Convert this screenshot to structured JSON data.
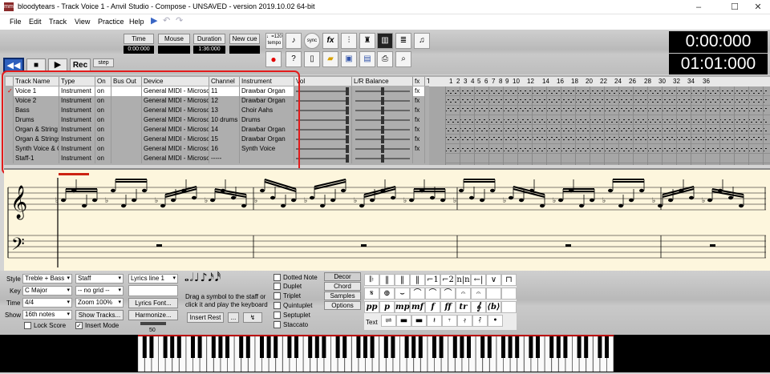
{
  "window": {
    "title": "bloodytears - Track Voice 1 - Anvil Studio - Compose - UNSAVED - version 2019.10.02 64-bit",
    "app_icon": "mm"
  },
  "menu": [
    "File",
    "Edit",
    "Track",
    "View",
    "Practice",
    "Help"
  ],
  "toolbar": {
    "time_label": "Time",
    "mouse_label": "Mouse",
    "duration_label": "Duration",
    "newcue_label": "New cue",
    "time_value": "0:00:000",
    "duration_value": "1:36:000",
    "tempo_label": "♩=120\ntempo",
    "rec_label": "Rec",
    "step_label": "step",
    "sync_label": "sync",
    "fx_label": "fx"
  },
  "clock": {
    "elapsed": "0:00:000",
    "position": "01:01:000"
  },
  "tracks": {
    "headers": [
      "Track Name",
      "Type",
      "On",
      "Bus Out",
      "Device",
      "Channel",
      "Instrument",
      "Vol",
      "L/R Balance",
      "fx",
      "Time"
    ],
    "rows": [
      {
        "name": "Voice 1",
        "type": "Instrument",
        "on": "on",
        "bus": "",
        "device": "General MIDI - Microso",
        "channel": "11",
        "instrument": "Drawbar Organ",
        "fx": "fx"
      },
      {
        "name": "Voice 2",
        "type": "Instrument",
        "on": "on",
        "bus": "",
        "device": "General MIDI - Microso",
        "channel": "12",
        "instrument": "Drawbar Organ",
        "fx": "fx"
      },
      {
        "name": "Bass",
        "type": "Instrument",
        "on": "on",
        "bus": "",
        "device": "General MIDI - Microso",
        "channel": "13",
        "instrument": "Choir Aahs",
        "fx": "fx"
      },
      {
        "name": "Drums",
        "type": "Instrument",
        "on": "on",
        "bus": "",
        "device": "General MIDI - Microso",
        "channel": "10 drums",
        "instrument": "Drums",
        "fx": "fx"
      },
      {
        "name": "Organ & String E",
        "type": "Instrument",
        "on": "on",
        "bus": "",
        "device": "General MIDI - Microso",
        "channel": "14",
        "instrument": "Drawbar Organ",
        "fx": "fx"
      },
      {
        "name": "Organ & Strings",
        "type": "Instrument",
        "on": "on",
        "bus": "",
        "device": "General MIDI - Microso",
        "channel": "15",
        "instrument": "Drawbar Organ",
        "fx": "fx"
      },
      {
        "name": "Synth Voice & C",
        "type": "Instrument",
        "on": "on",
        "bus": "",
        "device": "General MIDI - Microso",
        "channel": "16",
        "instrument": "Synth Voice",
        "fx": "fx"
      },
      {
        "name": "Staff-1",
        "type": "Instrument",
        "on": "on",
        "bus": "",
        "device": "General MIDI - Microso",
        "channel": "-----",
        "instrument": "",
        "fx": ""
      }
    ],
    "measures": [
      "1",
      "2",
      "3",
      "4",
      "5",
      "6",
      "7",
      "8",
      "9",
      "10",
      "12",
      "14",
      "16",
      "18",
      "20",
      "22",
      "24",
      "26",
      "28",
      "30",
      "32",
      "34",
      "36"
    ]
  },
  "panel": {
    "style_label": "Style",
    "style_value": "Treble + Bass",
    "key_label": "Key",
    "key_value": "C Major",
    "time_label": "Time",
    "time_value": "4/4",
    "show_label": "Show",
    "show_value": "16th notes",
    "staff_value": "Staff",
    "grid_value": "-- no grid --",
    "zoom_value": "Zoom 100%",
    "show_tracks": "Show Tracks...",
    "lock_score": "Lock Score",
    "insert_mode": "Insert Mode",
    "lyrics_value": "Lyrics line 1",
    "lyrics_font": "Lyrics Font...",
    "harmonize": "Harmonize...",
    "slider_value": "50",
    "drag_hint_1": "Drag a symbol to the staff or",
    "drag_hint_2": "click it and play the keyboard",
    "insert_rest": "Insert Rest",
    "dots": "...",
    "dotted_note": "Dotted Note",
    "duplet": "Duplet",
    "triplet": "Triplet",
    "quintuplet": "Quintuplet",
    "septuplet": "Septuplet",
    "staccato": "Staccato",
    "tabs": [
      "Decor",
      "Chord",
      "Samples",
      "Options"
    ],
    "text_label": "Text",
    "symbols_row1": [
      "𝄆",
      "‖",
      "‖",
      "‖",
      "⌐1",
      "⌐2",
      "n|n",
      "←|",
      "∨",
      "⊓"
    ],
    "symbols_row2": [
      "𝄋",
      "⊕",
      "⌣",
      "⌒",
      "⌒",
      "⌒",
      "𝄐",
      "𝄐",
      "",
      ""
    ],
    "symbols_row3": [
      "pp",
      "p",
      "mp",
      "mf",
      "f",
      "ff",
      "tr",
      "𝄞",
      "⟨b⟩",
      ""
    ],
    "symbols_row4": [
      "⇌",
      "▬",
      "▬",
      "𝄽",
      "𝄾",
      "𝄿",
      "𝅀",
      "•"
    ]
  },
  "colors": {
    "accent_red": "#e31b1b",
    "lcd_bg": "#000000",
    "score_bg": "#fdf6dd"
  }
}
